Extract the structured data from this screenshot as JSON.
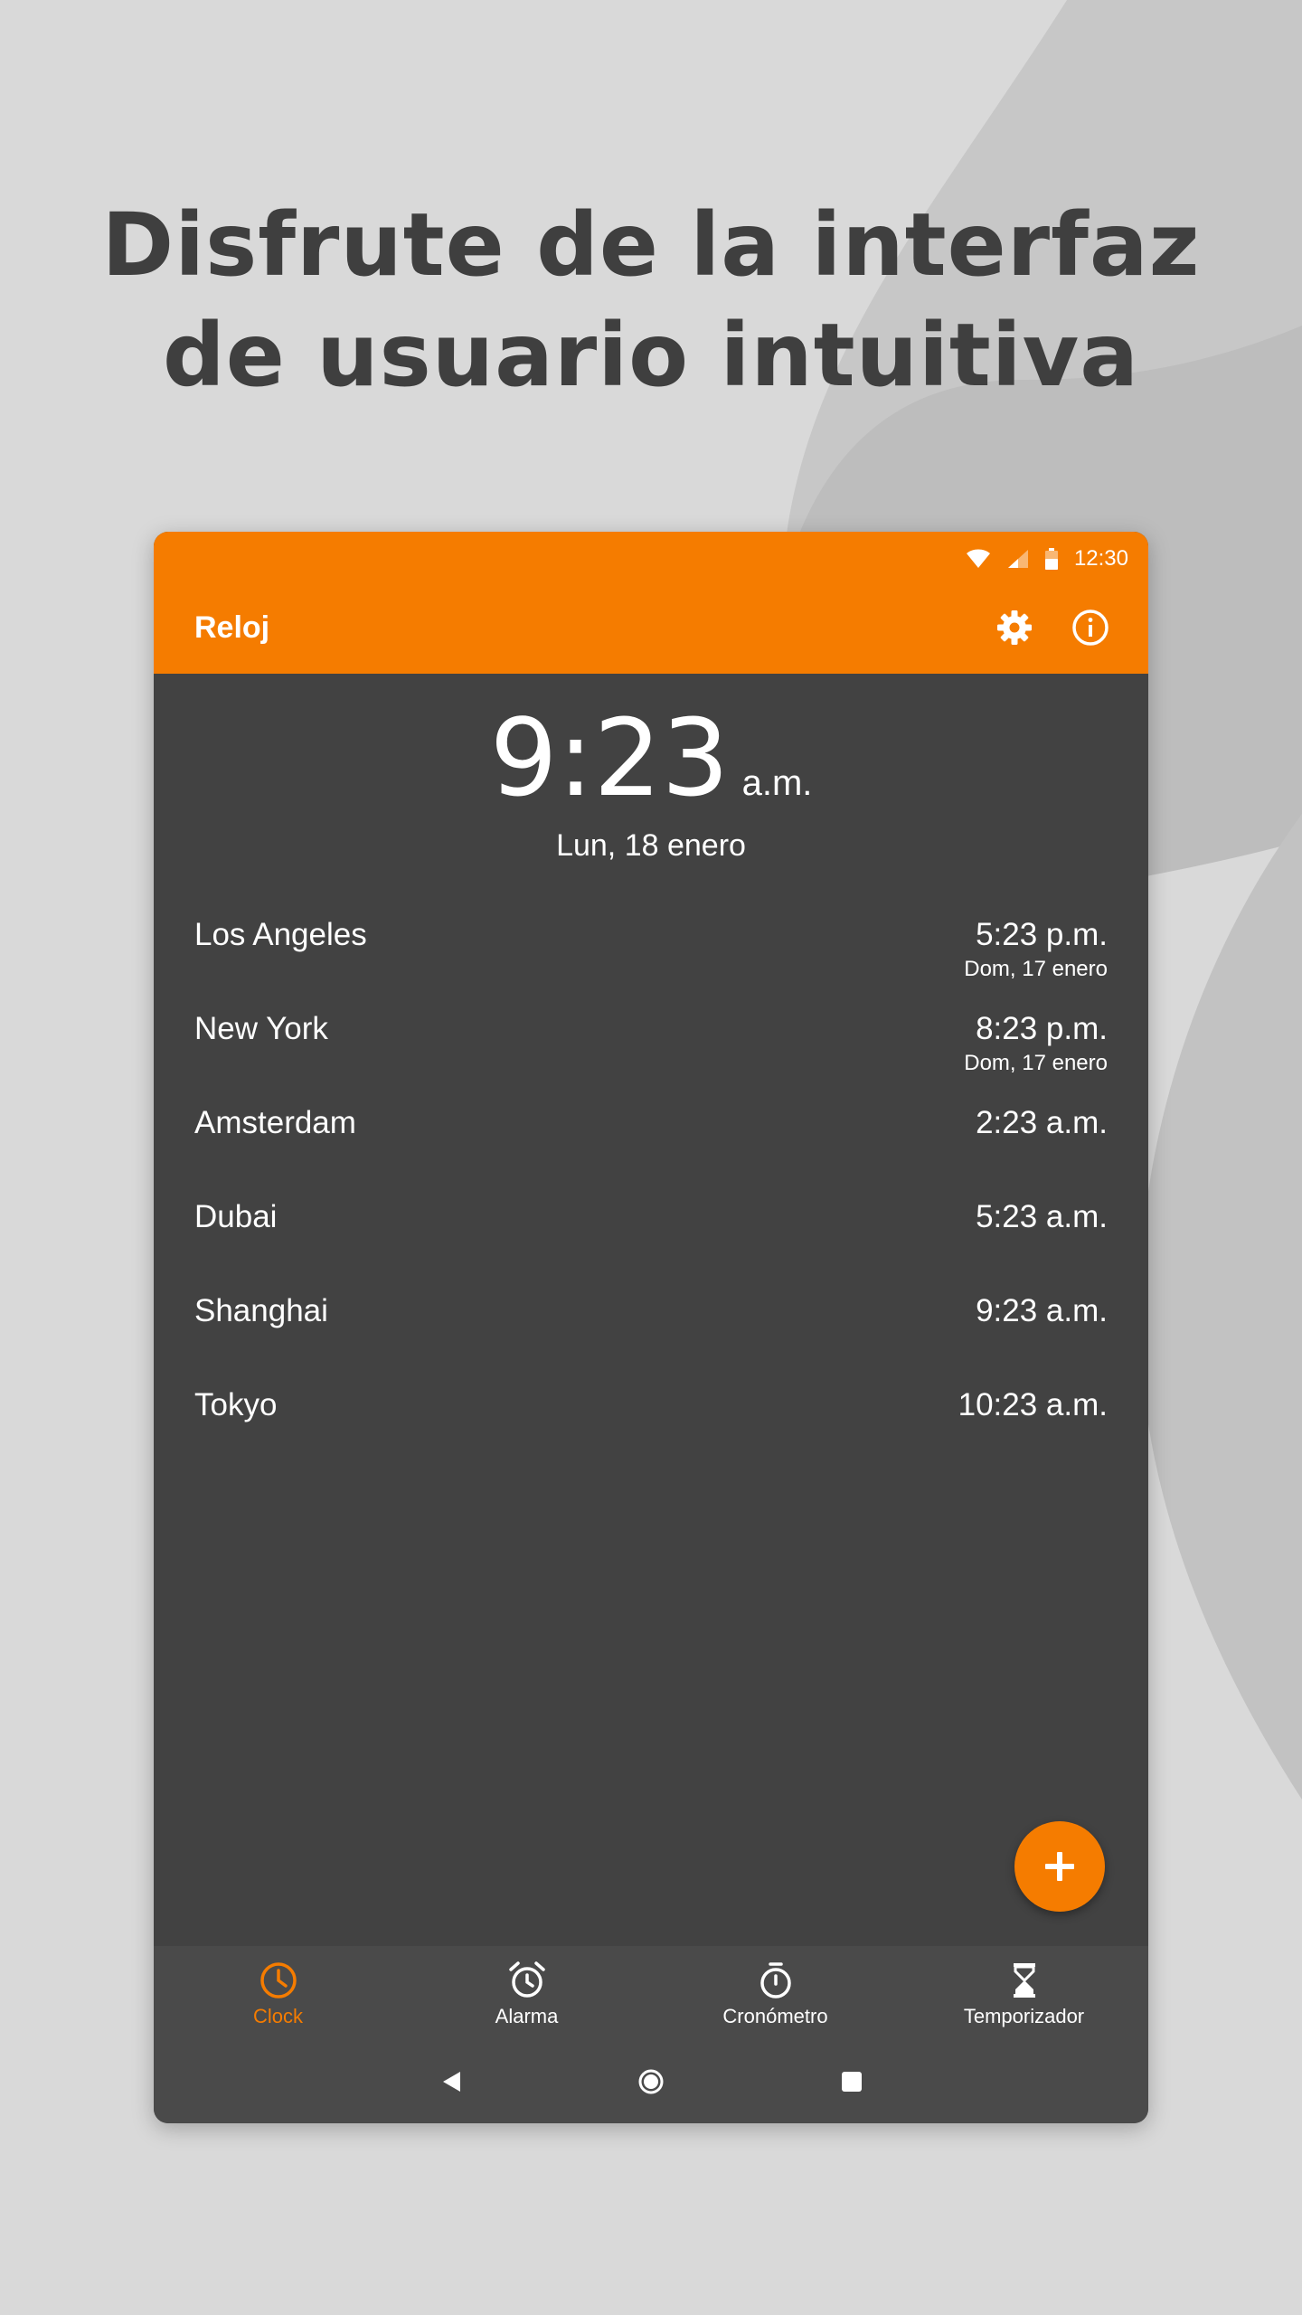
{
  "headline": {
    "line1": "Disfrute de la interfaz",
    "line2": "de usuario intuitiva"
  },
  "status_bar": {
    "time": "12:30",
    "icons": [
      "wifi-icon",
      "cell-signal-icon",
      "battery-icon"
    ]
  },
  "app_bar": {
    "title": "Reloj",
    "actions": [
      "gear-icon",
      "info-icon"
    ]
  },
  "main_clock": {
    "time": "9:23",
    "ampm": "a.m.",
    "date": "Lun, 18 enero"
  },
  "cities": [
    {
      "name": "Los Angeles",
      "time": "5:23 p.m.",
      "date": "Dom, 17 enero"
    },
    {
      "name": "New York",
      "time": "8:23 p.m.",
      "date": "Dom, 17 enero"
    },
    {
      "name": "Amsterdam",
      "time": "2:23 a.m.",
      "date": ""
    },
    {
      "name": "Dubai",
      "time": "5:23 a.m.",
      "date": ""
    },
    {
      "name": "Shanghai",
      "time": "9:23 a.m.",
      "date": ""
    },
    {
      "name": "Tokyo",
      "time": "10:23 a.m.",
      "date": ""
    }
  ],
  "fab": {
    "icon": "plus-icon"
  },
  "bottom_nav": {
    "tabs": [
      {
        "label": "Clock",
        "icon": "clock-icon",
        "active": true
      },
      {
        "label": "Alarma",
        "icon": "alarm-clock-icon",
        "active": false
      },
      {
        "label": "Cronómetro",
        "icon": "stopwatch-icon",
        "active": false
      },
      {
        "label": "Temporizador",
        "icon": "hourglass-icon",
        "active": false
      }
    ]
  },
  "colors": {
    "accent": "#f57c00",
    "surface": "#424242",
    "nav_surface": "#4a4a4a",
    "page_background": "#d9d9d9",
    "headline_text": "#3f3f3f"
  }
}
